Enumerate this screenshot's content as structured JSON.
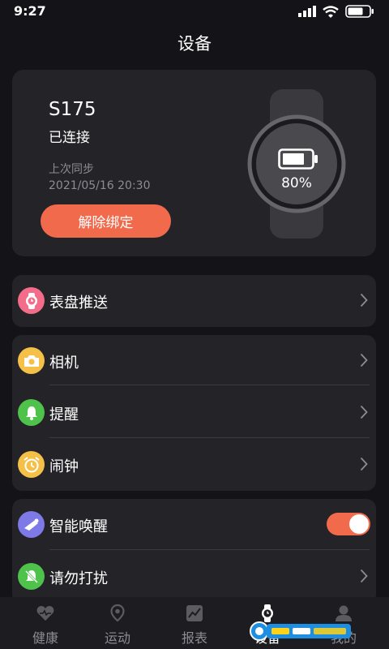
{
  "status_bar": {
    "time": "9:27"
  },
  "header": {
    "title": "设备"
  },
  "device": {
    "name": "S175",
    "status": "已连接",
    "sync_label": "上次同步",
    "sync_time": "2021/05/16   20:30",
    "unbind_label": "解除绑定",
    "battery": "80%"
  },
  "groups": [
    {
      "items": [
        {
          "label": "表盘推送",
          "icon": "watch-face-icon",
          "color": "#f36d8a"
        }
      ]
    },
    {
      "items": [
        {
          "label": "相机",
          "icon": "camera-icon",
          "color": "#f5c048"
        },
        {
          "label": "提醒",
          "icon": "bell-icon",
          "color": "#4fc24c"
        },
        {
          "label": "闹钟",
          "icon": "alarm-clock-icon",
          "color": "#f5c048"
        }
      ]
    },
    {
      "items": [
        {
          "label": "智能唤醒",
          "icon": "wake-icon",
          "color": "#7d79e6",
          "toggle_on": true
        },
        {
          "label": "请勿打扰",
          "icon": "do-not-disturb-icon",
          "color": "#4fc24c"
        }
      ]
    }
  ],
  "nav": [
    {
      "label": "健康",
      "icon": "heart-icon"
    },
    {
      "label": "运动",
      "icon": "location-icon"
    },
    {
      "label": "报表",
      "icon": "chart-icon"
    },
    {
      "label": "设备",
      "icon": "watch-icon",
      "active": true
    },
    {
      "label": "我的",
      "icon": "profile-icon"
    }
  ],
  "colors": {
    "accent": "#f26a4c",
    "card": "#232328",
    "background": "#131318"
  }
}
